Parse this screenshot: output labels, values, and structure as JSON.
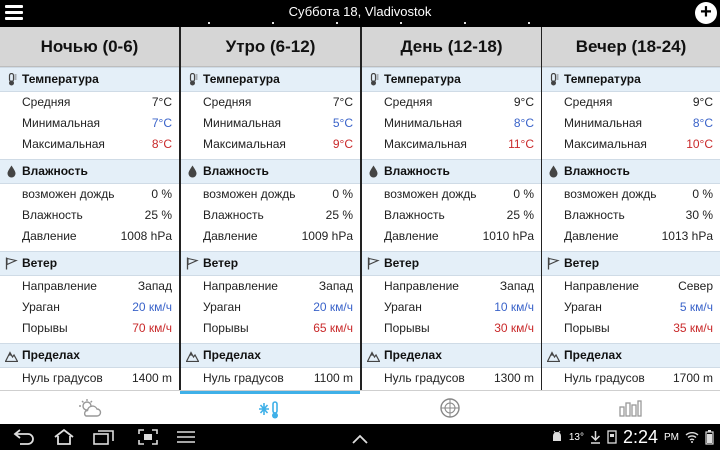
{
  "header": {
    "title": "Суббота 18, Vladivostok",
    "menu_icon": "hamburger-menu-icon",
    "add_icon": "add-icon",
    "add_label": "+"
  },
  "sections": {
    "temperature": "Температура",
    "humidity": "Влажность",
    "wind": "Ветер",
    "limits": "Пределах"
  },
  "labels": {
    "avg": "Средняя",
    "min": "Минимальная",
    "max": "Максимальная",
    "rain": "возможен дождь",
    "humidity": "Влажность",
    "pressure": "Давление",
    "direction": "Направление",
    "gust_hurricane": "Ураган",
    "gusts": "Порывы",
    "zero_deg": "Нуль градусов"
  },
  "columns": [
    {
      "title": "Ночью (0-6)",
      "avg": "7°C",
      "min": "7°C",
      "max": "8°C",
      "rain": "0 %",
      "humidity": "25 %",
      "pressure": "1008 hPa",
      "direction": "Запад",
      "hurricane": "20 км/ч",
      "gusts": "70 км/ч",
      "zero_deg": "1400 m"
    },
    {
      "title": "Утро (6-12)",
      "avg": "7°C",
      "min": "5°C",
      "max": "9°C",
      "rain": "0 %",
      "humidity": "25 %",
      "pressure": "1009 hPa",
      "direction": "Запад",
      "hurricane": "20 км/ч",
      "gusts": "65 км/ч",
      "zero_deg": "1100 m"
    },
    {
      "title": "День (12-18)",
      "avg": "9°C",
      "min": "8°C",
      "max": "11°C",
      "rain": "0 %",
      "humidity": "25 %",
      "pressure": "1010 hPa",
      "direction": "Запад",
      "hurricane": "10 км/ч",
      "gusts": "30 км/ч",
      "zero_deg": "1300 m"
    },
    {
      "title": "Вечер (18-24)",
      "avg": "9°C",
      "min": "8°C",
      "max": "10°C",
      "rain": "0 %",
      "humidity": "30 %",
      "pressure": "1013 hPa",
      "direction": "Север",
      "hurricane": "5 км/ч",
      "gusts": "35 км/ч",
      "zero_deg": "1700 m"
    }
  ],
  "tabs": [
    {
      "icon": "partly-cloudy-icon",
      "active": false
    },
    {
      "icon": "snow-thermometer-icon",
      "active": true
    },
    {
      "icon": "compass-radar-icon",
      "active": false
    },
    {
      "icon": "bar-chart-icon",
      "active": false
    }
  ],
  "status_bar": {
    "temperature": "13°",
    "time": "2:24",
    "meridiem": "PM"
  },
  "colors": {
    "accent": "#3fb0e8",
    "min_temp": "#3a63c9",
    "max_temp": "#c9292a",
    "section_bg": "#e4eff8",
    "header_bg": "#d6d6d6"
  }
}
